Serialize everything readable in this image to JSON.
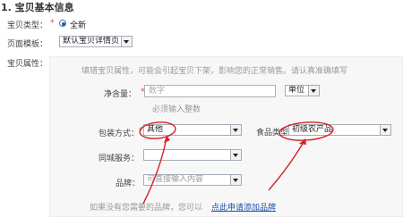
{
  "section": {
    "title": "1. 宝贝基本信息"
  },
  "item_type": {
    "label": "宝贝类型：",
    "required_mark": "*",
    "option": "全新"
  },
  "page_template": {
    "label": "页面模板：",
    "selected": "默认宝贝详情页"
  },
  "item_attributes": {
    "label": "宝贝属性：",
    "hint": "填错宝贝属性，可能会引起宝贝下架，影响您的正常销售。请认真准确填写",
    "net_content": {
      "label": "净含量：",
      "required_mark": "*",
      "placeholder": "数字",
      "unit_selected": "单位",
      "note": "必须输入整数"
    },
    "packaging": {
      "label": "包装方式：",
      "required_mark": "*",
      "selected": "其他"
    },
    "food_type": {
      "label": "食品类型",
      "selected": "初级农产品"
    },
    "local_service": {
      "label": "同城服务：",
      "selected": ""
    },
    "brand": {
      "label": "品牌：",
      "placeholder": "可直接输入内容"
    },
    "footer": {
      "text": "如果没有您需要的品牌，您可以",
      "link": "点此申请添加品牌"
    }
  },
  "colors": {
    "annotation": "#d2232a",
    "panel_bg": "#f7f7f7",
    "link": "#1d4fa8",
    "required": "#e4393c"
  }
}
